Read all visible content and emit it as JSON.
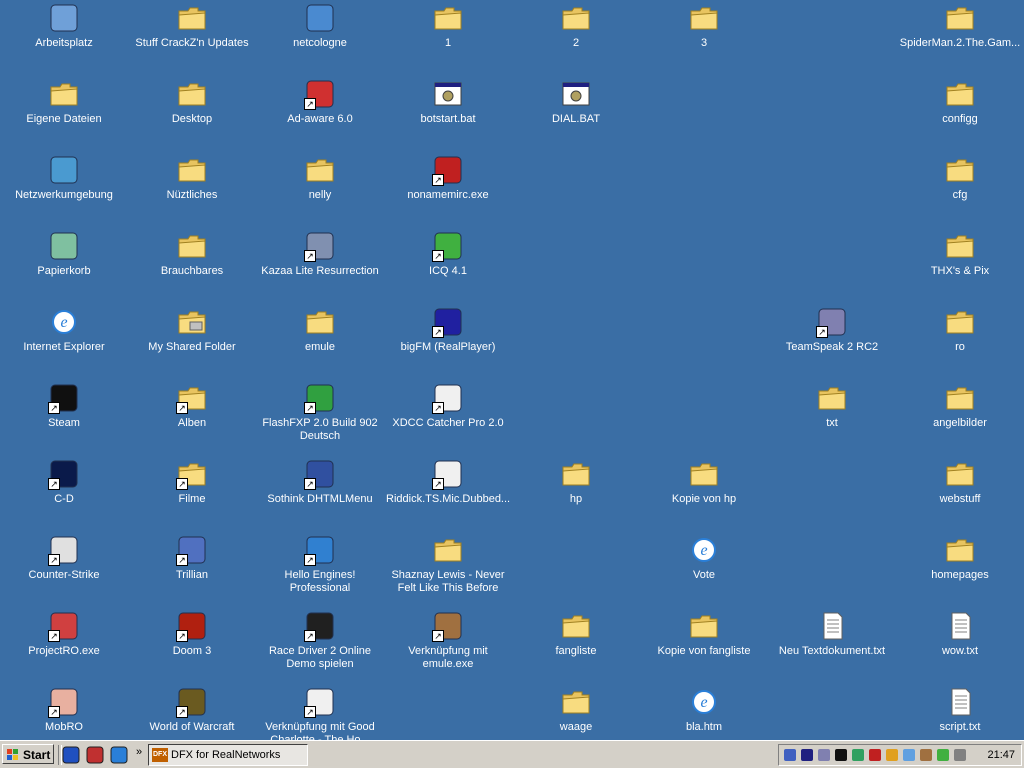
{
  "desktop": {
    "background": "#3a6ea5",
    "columns": [
      [
        {
          "label": "Arbeitsplatz",
          "icon": "my-computer-icon",
          "type": "gen",
          "color": "#6fa0d8",
          "shortcut": false
        },
        {
          "label": "Eigene Dateien",
          "icon": "my-documents-icon",
          "type": "folder",
          "shortcut": false
        },
        {
          "label": "Netzwerkumgebung",
          "icon": "network-icon",
          "type": "gen",
          "color": "#4a9ad0",
          "shortcut": false
        },
        {
          "label": "Papierkorb",
          "icon": "recycle-bin-icon",
          "type": "gen",
          "color": "#7fc0a0",
          "shortcut": false
        },
        {
          "label": "Internet Explorer",
          "icon": "internet-explorer-icon",
          "type": "gen",
          "color": "#2a7fd8",
          "shortcut": false
        },
        {
          "label": "Steam",
          "icon": "steam-icon",
          "type": "gen",
          "color": "#101010",
          "shortcut": true
        },
        {
          "label": "C-D",
          "icon": "c-d-icon",
          "type": "gen",
          "color": "#0a1a4a",
          "shortcut": true
        },
        {
          "label": "Counter-Strike",
          "icon": "counter-strike-icon",
          "type": "gen",
          "color": "#e0e0e0",
          "shortcut": true
        },
        {
          "label": "ProjectRO.exe",
          "icon": "projectro-icon",
          "type": "gen",
          "color": "#d04040",
          "shortcut": true
        },
        {
          "label": "MobRO",
          "icon": "mobro-icon",
          "type": "gen",
          "color": "#e8b0a0",
          "shortcut": true
        }
      ],
      [
        {
          "label": "Stuff CrackZ'n Updates",
          "icon": "folder-icon",
          "type": "folder",
          "shortcut": false
        },
        {
          "label": "Desktop",
          "icon": "folder-icon",
          "type": "folder",
          "shortcut": false
        },
        {
          "label": "Nüztliches",
          "icon": "folder-icon",
          "type": "folder",
          "shortcut": false
        },
        {
          "label": "Brauchbares",
          "icon": "folder-icon",
          "type": "folder",
          "shortcut": false
        },
        {
          "label": "My Shared Folder",
          "icon": "shared-folder-icon",
          "type": "folder",
          "shortcut": false
        },
        {
          "label": "Alben",
          "icon": "folder-icon",
          "type": "folder",
          "shortcut": true
        },
        {
          "label": "Filme",
          "icon": "folder-icon",
          "type": "folder",
          "shortcut": true
        },
        {
          "label": "Trillian",
          "icon": "trillian-icon",
          "type": "gen",
          "color": "#5070c0",
          "shortcut": true
        },
        {
          "label": "Doom 3",
          "icon": "doom3-icon",
          "type": "gen",
          "color": "#b02010",
          "shortcut": true
        },
        {
          "label": "World of Warcraft",
          "icon": "wow-icon",
          "type": "gen",
          "color": "#6a5a20",
          "shortcut": true
        }
      ],
      [
        {
          "label": "netcologne",
          "icon": "netcologne-icon",
          "type": "gen",
          "color": "#4a8ad0",
          "shortcut": false
        },
        {
          "label": "Ad-aware 6.0",
          "icon": "ad-aware-icon",
          "type": "gen",
          "color": "#d03030",
          "shortcut": true
        },
        {
          "label": "nelly",
          "icon": "folder-icon",
          "type": "folder",
          "shortcut": false
        },
        {
          "label": "Kazaa Lite Resurrection",
          "icon": "kazaa-icon",
          "type": "gen",
          "color": "#8090b0",
          "shortcut": true
        },
        {
          "label": "emule",
          "icon": "folder-icon",
          "type": "folder",
          "shortcut": false
        },
        {
          "label": "FlashFXP 2.0 Build 902 Deutsch",
          "icon": "flashfxp-icon",
          "type": "gen",
          "color": "#30a040",
          "shortcut": true
        },
        {
          "label": "Sothink DHTMLMenu",
          "icon": "sothink-icon",
          "type": "gen",
          "color": "#3050a0",
          "shortcut": true
        },
        {
          "label": "Hello Engines! Professional",
          "icon": "hello-engines-icon",
          "type": "gen",
          "color": "#3080d0",
          "shortcut": true
        },
        {
          "label": "Race Driver 2 Online Demo spielen",
          "icon": "race-driver-icon",
          "type": "gen",
          "color": "#202020",
          "shortcut": true
        },
        {
          "label": "Verknüpfung mit Good Charlotte - The Ho...",
          "icon": "media-icon",
          "type": "gen",
          "color": "#f0f0f0",
          "shortcut": true
        }
      ],
      [
        {
          "label": "1",
          "icon": "folder-icon",
          "type": "folder",
          "shortcut": false
        },
        {
          "label": "botstart.bat",
          "icon": "batch-file-icon",
          "type": "gen",
          "color": "#c0c0c0",
          "shortcut": false
        },
        {
          "label": "nonamemirc.exe",
          "icon": "mirc-icon",
          "type": "gen",
          "color": "#c02020",
          "shortcut": true
        },
        {
          "label": "ICQ 4.1",
          "icon": "icq-icon",
          "type": "gen",
          "color": "#40b040",
          "shortcut": true
        },
        {
          "label": "bigFM (RealPlayer)",
          "icon": "bigfm-icon",
          "type": "gen",
          "color": "#2020a0",
          "shortcut": true
        },
        {
          "label": "XDCC Catcher Pro 2.0",
          "icon": "speaker-icon",
          "type": "gen",
          "color": "#f0f0f0",
          "shortcut": true
        },
        {
          "label": "Riddick.TS.Mic.Dubbed...",
          "icon": "media-icon",
          "type": "gen",
          "color": "#f0f0f0",
          "shortcut": true
        },
        {
          "label": "Shaznay Lewis - Never Felt Like This Before",
          "icon": "folder-icon",
          "type": "folder",
          "shortcut": false
        },
        {
          "label": "Verknüpfung mit emule.exe",
          "icon": "emule-icon",
          "type": "gen",
          "color": "#a07040",
          "shortcut": true
        }
      ],
      [
        {
          "label": "2",
          "icon": "folder-icon",
          "type": "folder",
          "shortcut": false
        },
        {
          "label": "DIAL.BAT",
          "icon": "batch-file-icon",
          "type": "gen",
          "color": "#c0c0c0",
          "shortcut": false
        },
        {
          "label": "hp",
          "icon": "folder-icon",
          "type": "folder",
          "shortcut": false
        },
        {
          "label": "fangliste",
          "icon": "folder-icon",
          "type": "folder",
          "shortcut": false
        },
        {
          "label": "waage",
          "icon": "folder-icon",
          "type": "folder",
          "shortcut": false
        }
      ],
      [
        {
          "label": "3",
          "icon": "folder-icon",
          "type": "folder",
          "shortcut": false
        },
        {
          "label": "Kopie von hp",
          "icon": "folder-icon",
          "type": "folder",
          "shortcut": false
        },
        {
          "label": "Vote",
          "icon": "html-file-icon",
          "type": "gen",
          "color": "#2a7fd8",
          "shortcut": false
        },
        {
          "label": "Kopie von fangliste",
          "icon": "folder-icon",
          "type": "folder",
          "shortcut": false
        },
        {
          "label": "bla.htm",
          "icon": "html-file-icon",
          "type": "gen",
          "color": "#2a7fd8",
          "shortcut": false
        }
      ],
      [
        {
          "label": "TeamSpeak 2 RC2",
          "icon": "teamspeak-icon",
          "type": "gen",
          "color": "#8080b0",
          "shortcut": true
        },
        {
          "label": "txt",
          "icon": "folder-icon",
          "type": "folder",
          "shortcut": false
        },
        {
          "label": "Neu Textdokument.txt",
          "icon": "text-file-icon",
          "type": "gen",
          "color": "#ffffff",
          "shortcut": false
        }
      ],
      [
        {
          "label": "SpiderMan.2.The.Gam...",
          "icon": "folder-icon",
          "type": "folder",
          "shortcut": false
        },
        {
          "label": "configg",
          "icon": "folder-icon",
          "type": "folder",
          "shortcut": false
        },
        {
          "label": "cfg",
          "icon": "folder-icon",
          "type": "folder",
          "shortcut": false
        },
        {
          "label": "THX's & Pix",
          "icon": "folder-icon",
          "type": "folder",
          "shortcut": false
        },
        {
          "label": "ro",
          "icon": "folder-icon",
          "type": "folder",
          "shortcut": false
        },
        {
          "label": "angelbilder",
          "icon": "folder-icon",
          "type": "folder",
          "shortcut": false
        },
        {
          "label": "webstuff",
          "icon": "folder-icon",
          "type": "folder",
          "shortcut": false
        },
        {
          "label": "homepages",
          "icon": "folder-icon",
          "type": "folder",
          "shortcut": false
        },
        {
          "label": "wow.txt",
          "icon": "text-file-icon",
          "type": "gen",
          "color": "#ffffff",
          "shortcut": false
        },
        {
          "label": "script.txt",
          "icon": "text-file-icon",
          "type": "gen",
          "color": "#ffffff",
          "shortcut": false
        }
      ]
    ]
  },
  "taskbar": {
    "start_label": "Start",
    "quick_launch": [
      "show-desktop-icon",
      "media-icon",
      "internet-explorer-icon"
    ],
    "overflow": "»",
    "tasks": [
      {
        "label": "DFX for RealNetworks",
        "icon": "dfx-icon",
        "badge": "DFX"
      }
    ],
    "tray_icons": [
      "network-icon",
      "bigfm-icon",
      "teamspeak-icon",
      "steam-icon",
      "monitor-icon",
      "antivirus-icon",
      "flashget-icon",
      "mail-icon",
      "emule-icon",
      "icq-icon",
      "volume-icon"
    ],
    "clock": "21:47"
  }
}
